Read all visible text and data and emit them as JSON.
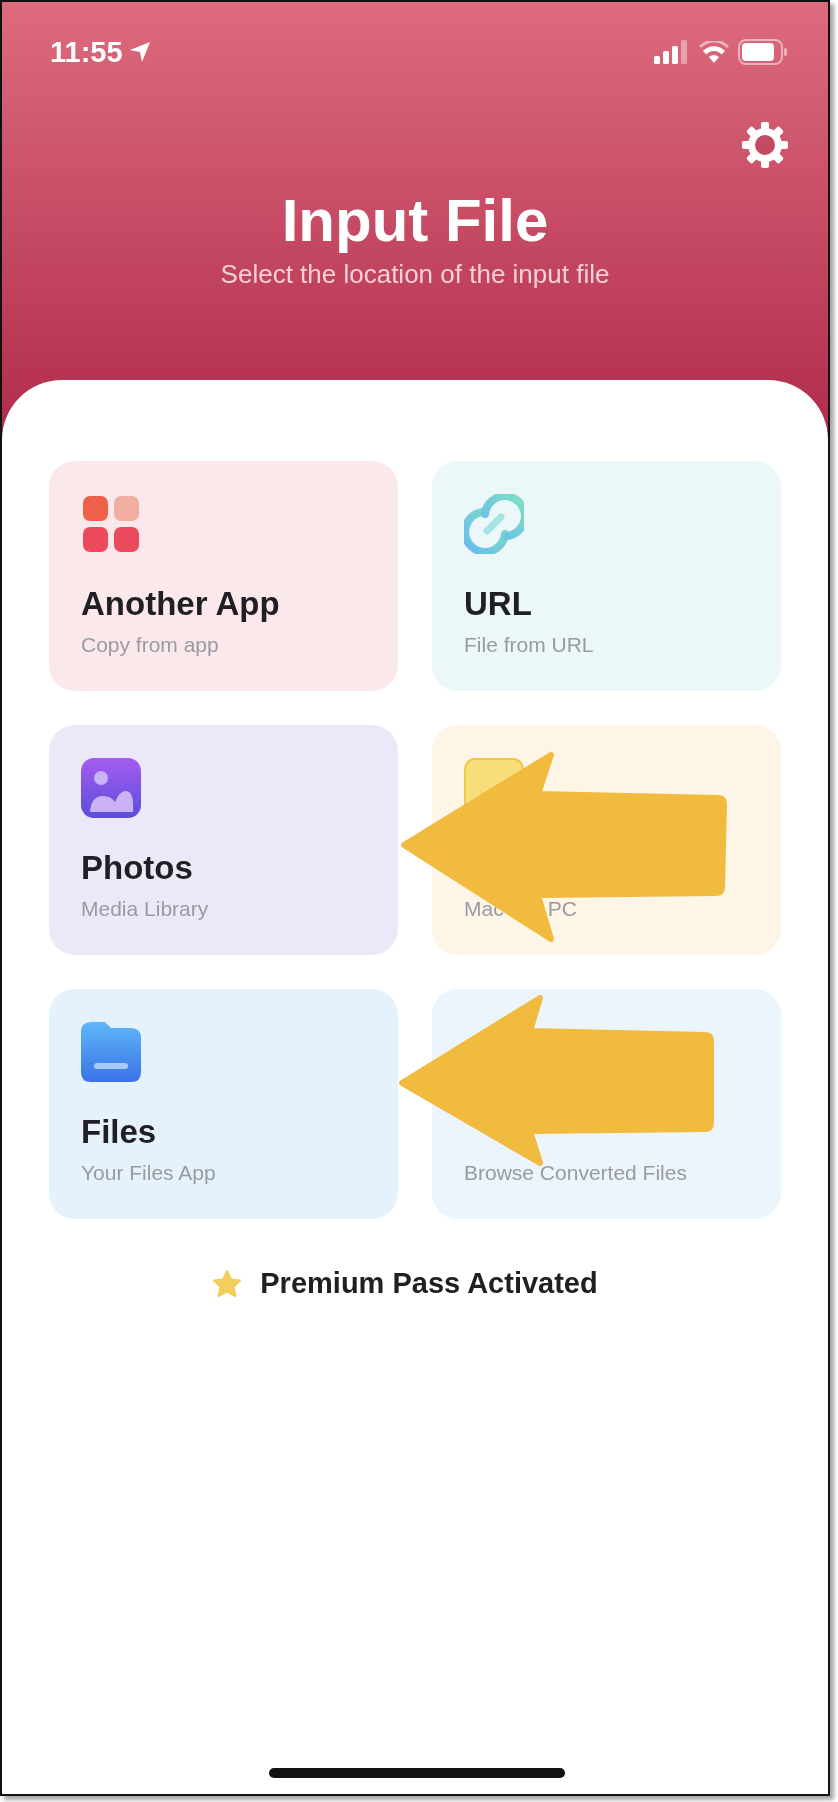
{
  "status_bar": {
    "time": "11:55"
  },
  "header": {
    "title": "Input File",
    "subtitle": "Select the location of the input file"
  },
  "cards": [
    {
      "kind": "apps",
      "title": "Another App",
      "subtitle": "Copy from app"
    },
    {
      "kind": "link",
      "title": "URL",
      "subtitle": "File from URL"
    },
    {
      "kind": "photos",
      "title": "Photos",
      "subtitle": "Media Library"
    },
    {
      "kind": "computer",
      "subtitle_parts": [
        "Mac",
        "PC"
      ]
    },
    {
      "kind": "files",
      "title": "Files",
      "subtitle": "Your Files App"
    },
    {
      "kind": "history",
      "subtitle": "Browse Converted Files"
    }
  ],
  "premium": {
    "label": "Premium Pass Activated"
  }
}
